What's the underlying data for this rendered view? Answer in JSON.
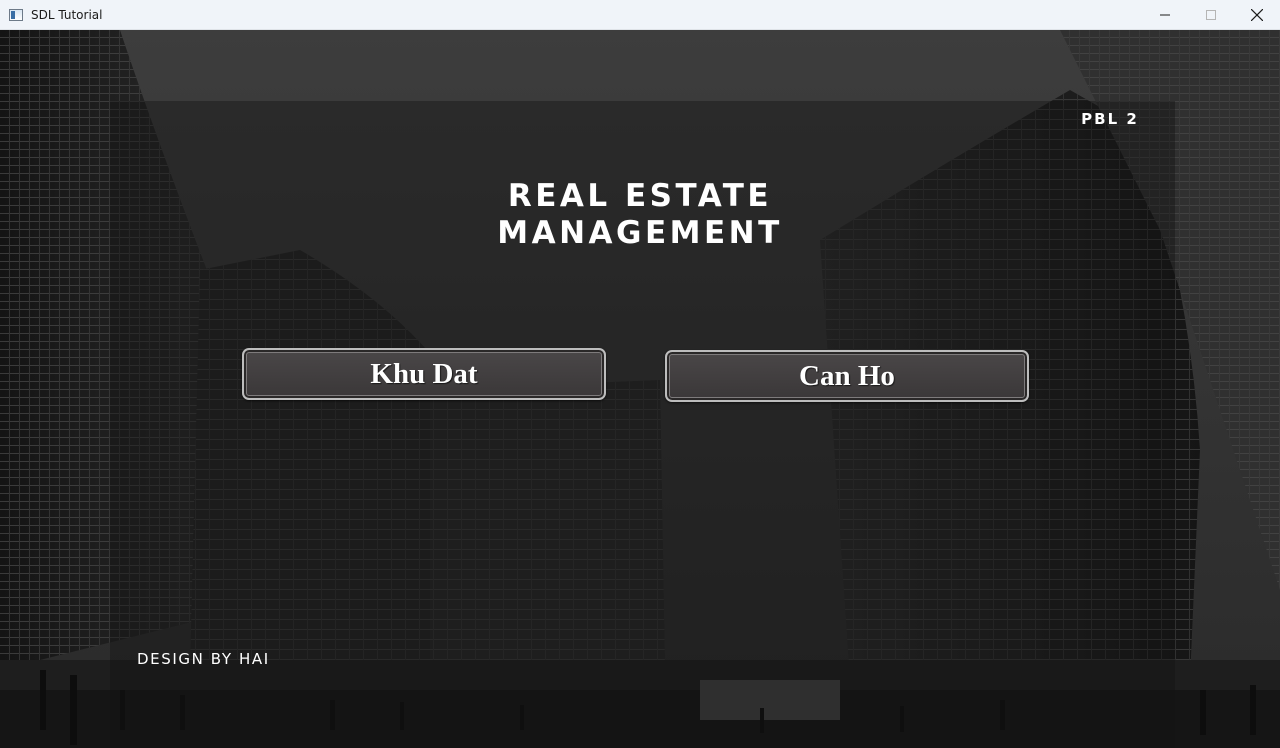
{
  "window": {
    "title": "SDL Tutorial",
    "icon": "app-window-icon",
    "controls": [
      "minimize-icon",
      "maximize-icon",
      "close-icon"
    ]
  },
  "header": {
    "badge": "PBL 2"
  },
  "main": {
    "title_line1": "REAL ESTATE",
    "title_line2": "MANAGEMENT",
    "buttons": [
      {
        "label": "Khu Dat"
      },
      {
        "label": "Can Ho"
      }
    ]
  },
  "footer": {
    "credit": "DESIGN BY HAI"
  },
  "colors": {
    "title_bar": "#f0f4f9",
    "text": "#ffffff",
    "button_fill": "#413e3f",
    "button_border": "#bdbdbd"
  }
}
